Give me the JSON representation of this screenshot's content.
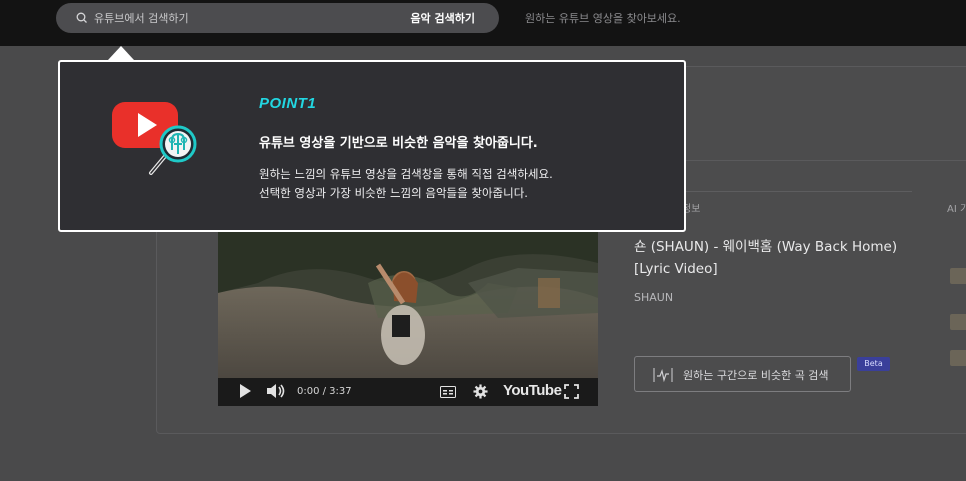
{
  "header": {
    "search_placeholder": "유튜브에서 검색하기",
    "search_button": "음악 검색하기",
    "hint": "원하는 유튜브 영상을 찾아보세요."
  },
  "tooltip": {
    "point": "POINT1",
    "heading": "유튜브 영상을 기반으로 비슷한 음악을 찾아줍니다.",
    "body_line1": "원하는 느낌의 유튜브 영상을 검색창을 통해 직접 검색하세요.",
    "body_line2": "선택한 영상과 가장 비슷한 느낌의 음악들을 찾아줍니다.",
    "accent_color": "#22d7e2"
  },
  "video": {
    "time": "0:00 / 3:37",
    "youtube_word": "YouTube"
  },
  "track": {
    "info_label": "정보",
    "title": "숀 (SHAUN) - 웨이백홈 (Way Back Home) [Lyric Video]",
    "artist": "SHAUN",
    "range_search_button": "원하는 구간으로 비슷한 곡 검색",
    "beta_badge": "Beta"
  },
  "side": {
    "label": "AI 기"
  },
  "icons": [
    "search-icon",
    "youtube-logo-icon",
    "magnifier-icon",
    "play-icon",
    "volume-icon",
    "captions-icon",
    "settings-icon",
    "fullscreen-icon",
    "waveform-icon"
  ]
}
